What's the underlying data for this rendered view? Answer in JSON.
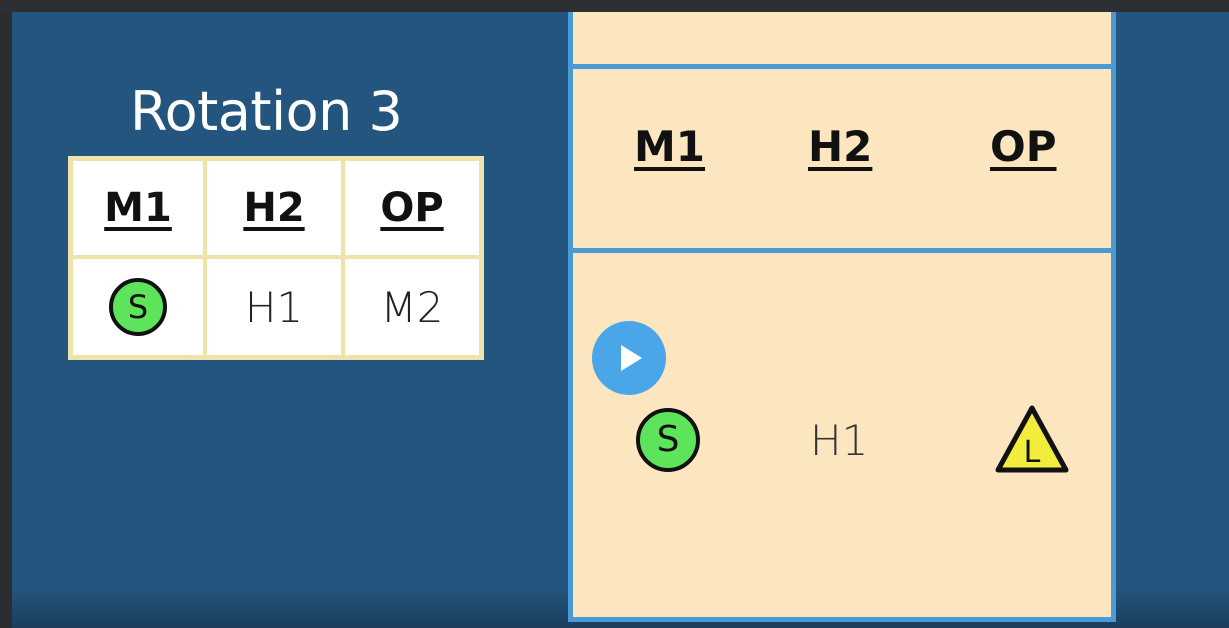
{
  "slide": {
    "title": "Rotation 3",
    "table": {
      "headers": [
        "M1",
        "H2",
        "OP"
      ],
      "row": [
        "S",
        "H1",
        "M2"
      ]
    },
    "court": {
      "headers": [
        "M1",
        "H2",
        "OP"
      ],
      "players": [
        "S",
        "H1",
        "L"
      ]
    }
  },
  "player": {
    "play_icon": "play-icon"
  },
  "colors": {
    "slide_bg": "#24557e",
    "court_bg": "#fbe6c0",
    "court_line": "#4a9ad8",
    "table_border": "#f0e3aa",
    "setter_green": "#5ee45a",
    "libero_yellow": "#f2ec3c",
    "play_button": "#4aa6e8"
  }
}
